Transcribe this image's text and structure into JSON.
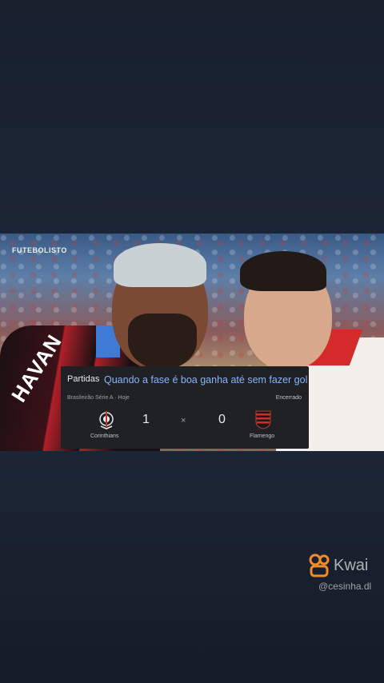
{
  "video": {
    "channel_watermark": "FUTEBOLISTO",
    "shirt_text": "HAVAN"
  },
  "card": {
    "tab_label": "Partidas",
    "query": "Quando a fase é boa ganha até sem fazer gol",
    "league": "Brasileirão Série A · Hoje",
    "status": "Encerrado",
    "home_team": "Corinthians",
    "away_team": "Flamengo",
    "home_score": "1",
    "separator": "×",
    "away_score": "0"
  },
  "kwai": {
    "brand": "Kwai",
    "handle": "@cesinha.dl",
    "icon": "kwai-logo-icon",
    "color": "#f28b2c"
  },
  "colors": {
    "background": "#1b2433",
    "card_bg": "#202124",
    "query_link": "#8ab4f8"
  }
}
